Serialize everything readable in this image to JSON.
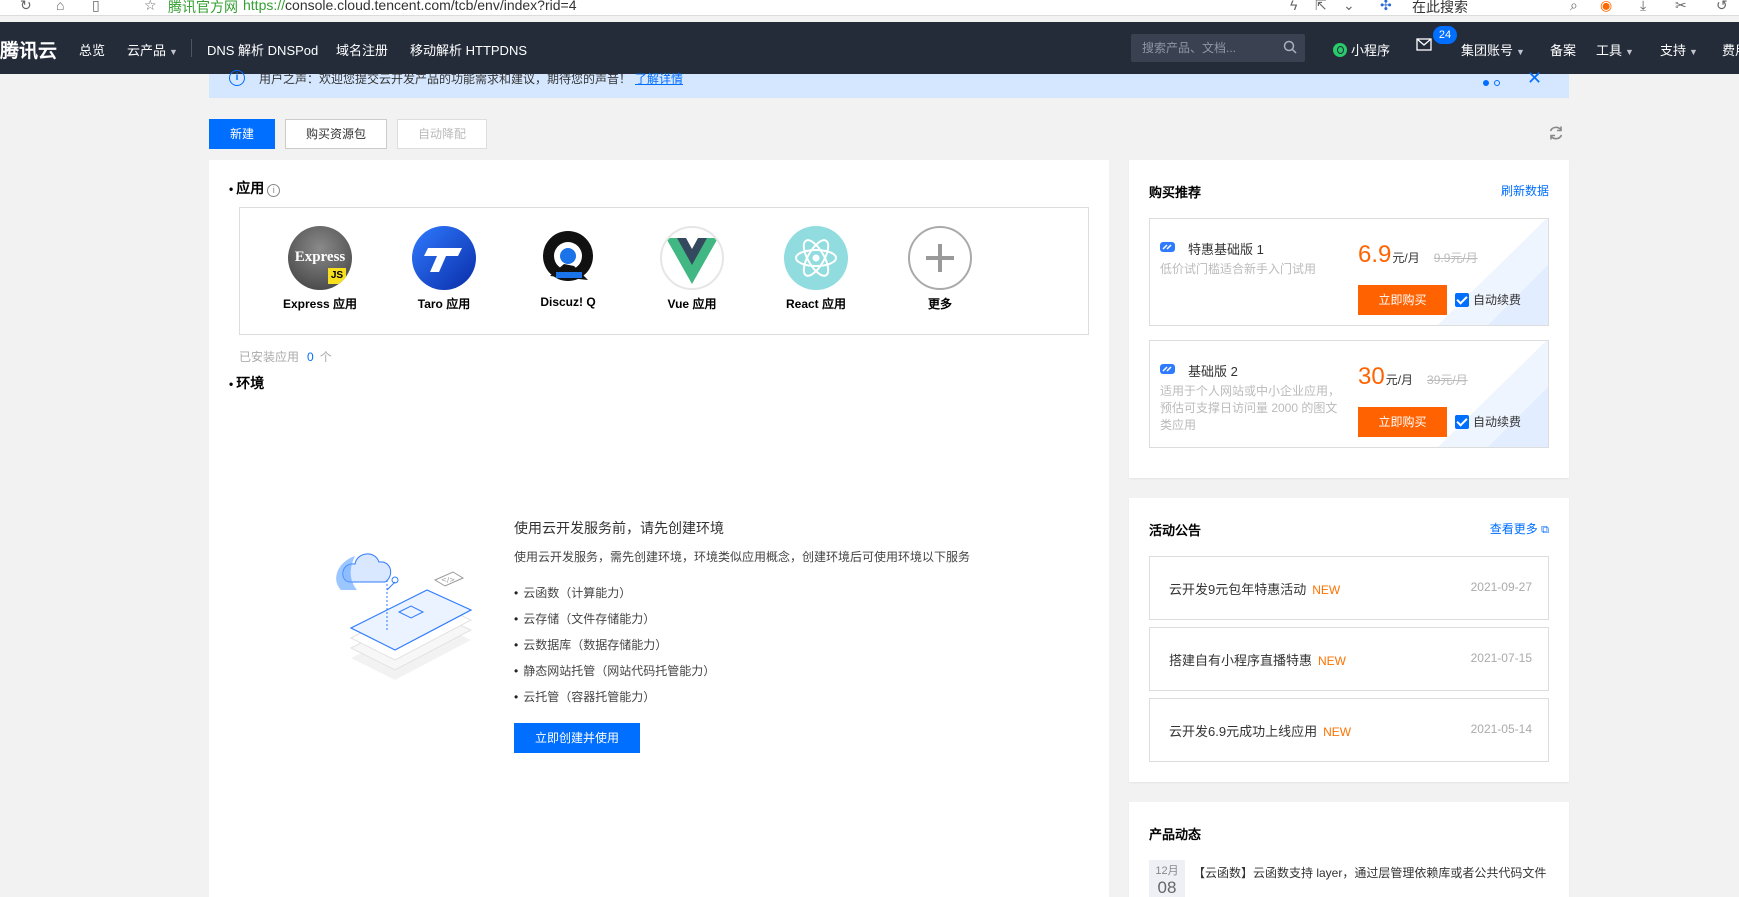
{
  "browser": {
    "site_name": "腾讯官方网",
    "url_proto": "https://",
    "url_rest": "console.cloud.tencent.com/tcb/env/index?rid=4",
    "search_label": "在此搜索"
  },
  "nav": {
    "logo": "腾讯云",
    "items": [
      "总览",
      "云产品",
      "DNS 解析 DNSPod",
      "域名注册",
      "移动解析 HTTPDNS"
    ],
    "search_placeholder": "搜索产品、文档...",
    "mini_program": "小程序",
    "mail_badge": "24",
    "group_account": "集团账号",
    "record": "备案",
    "tools": "工具",
    "support": "支持",
    "overflow": "费用"
  },
  "notice": {
    "text": "用户之声：欢迎您提交云开发产品的功能需求和建议，期待您的声音！",
    "link": "了解详情"
  },
  "toolbar": {
    "new_label": "新建",
    "buy_pack_label": "购买资源包",
    "auto_downgrade_label": "自动降配"
  },
  "apps": {
    "title": "应用",
    "items": [
      {
        "label": "Express 应用"
      },
      {
        "label": "Taro 应用"
      },
      {
        "label": "Discuz! Q"
      },
      {
        "label": "Vue 应用"
      },
      {
        "label": "React 应用"
      },
      {
        "label": "更多"
      }
    ],
    "installed_label": "已安装应用",
    "installed_count": "0",
    "installed_unit": "个"
  },
  "env": {
    "title": "环境",
    "empty_title": "使用云开发服务前，请先创建环境",
    "empty_desc": "使用云开发服务，需先创建环境，环境类似应用概念，创建环境后可使用环境以下服务",
    "services": [
      "云函数（计算能力）",
      "云存储（文件存储能力）",
      "云数据库（数据存储能力）",
      "静态网站托管（网站代码托管能力）",
      "云托管（容器托管能力）"
    ],
    "create_button": "立即创建并使用"
  },
  "recommend": {
    "title": "购买推荐",
    "refresh_label": "刷新数据",
    "items": [
      {
        "name": "特惠基础版 1",
        "desc": "低价试门槛适合新手入门试用",
        "price": "6.9",
        "unit": "元/月",
        "orig": "9.9元/月",
        "buy": "立即购买",
        "renew": "自动续费"
      },
      {
        "name": "基础版 2",
        "desc": "适用于个人网站或中小企业应用，预估可支撑日访问量 2000 的图文类应用",
        "price": "30",
        "unit": "元/月",
        "orig": "39元/月",
        "buy": "立即购买",
        "renew": "自动续费"
      }
    ]
  },
  "announce": {
    "title": "活动公告",
    "more_label": "查看更多",
    "items": [
      {
        "title": "云开发9元包年特惠活动",
        "tag": "NEW",
        "date": "2021-09-27"
      },
      {
        "title": "搭建自有小程序直播特惠",
        "tag": "NEW",
        "date": "2021-07-15"
      },
      {
        "title": "云开发6.9元成功上线应用",
        "tag": "NEW",
        "date": "2021-05-14"
      }
    ]
  },
  "news": {
    "title": "产品动态",
    "month": "12月",
    "day": "08",
    "text": "【云函数】云函数支持 layer，通过层管理依赖库或者公共代码文件"
  },
  "colors": {
    "primary": "#006eff",
    "nav_bg": "#242c3a",
    "accent_orange": "#ff6200"
  }
}
